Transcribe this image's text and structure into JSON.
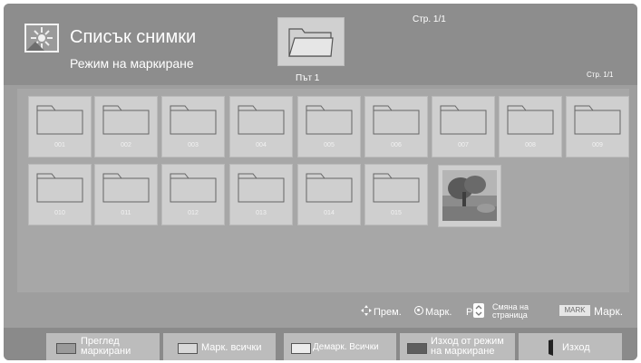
{
  "header": {
    "title": "Списък снимки",
    "subtitle": "Режим на маркиране",
    "page_top": "Стр. 1/1",
    "path_label": "Път 1",
    "page_right": "Стр. 1/1"
  },
  "grid": {
    "folders_row1": [
      "001",
      "002",
      "003",
      "004",
      "005",
      "006",
      "007",
      "008",
      "009"
    ],
    "folders_row2": [
      "010",
      "011",
      "012",
      "013",
      "014",
      "015"
    ]
  },
  "hints": {
    "move": "Прем.",
    "mark": "Марк.",
    "p_key": "P",
    "change_page_line1": "Смяна на",
    "change_page_line2": "страница",
    "mark_key": "MARK",
    "mark_key_label": "Марк."
  },
  "buttons": {
    "preview_marked_line1": "Преглед",
    "preview_marked_line2": "маркирани",
    "mark_all": "Марк. всички",
    "unmark_all": "Демарк. Всички",
    "exit_mark_mode_line1": "Изход от режим",
    "exit_mark_mode_line2": "на маркиране",
    "exit": "Изход"
  }
}
